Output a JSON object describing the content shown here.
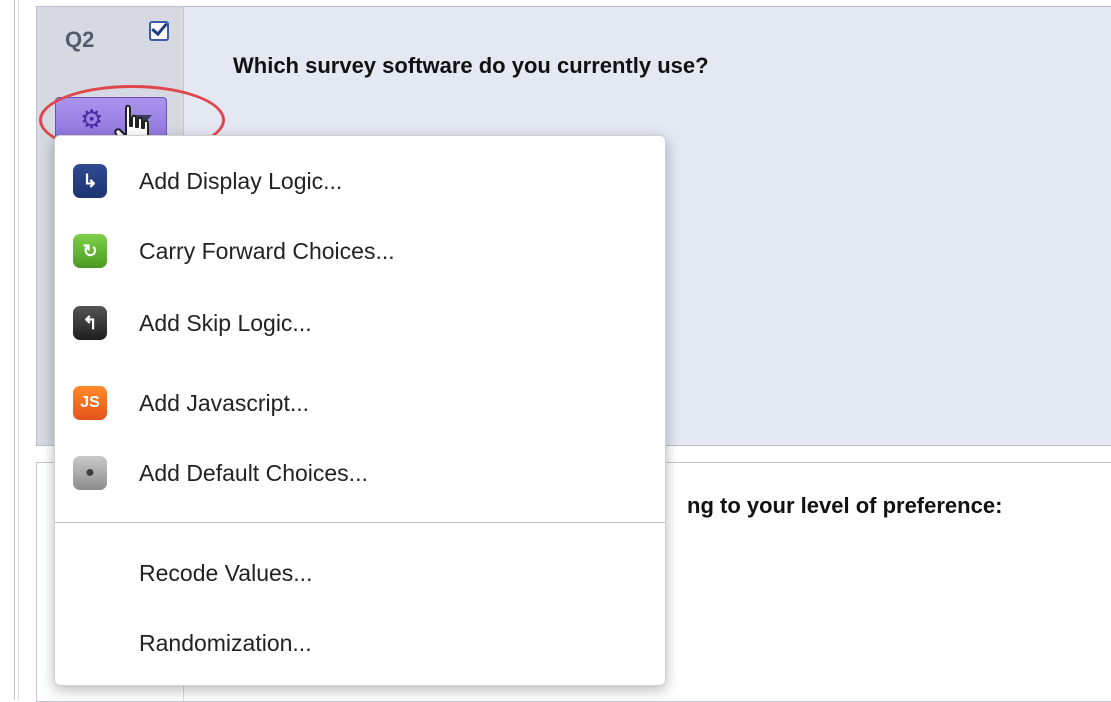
{
  "question2": {
    "number": "Q2",
    "text": "Which survey software do you currently use?"
  },
  "question3": {
    "text_visible": "ng to your level of preference:"
  },
  "menu": {
    "items": [
      {
        "label": "Add Display Logic...",
        "icon": "display-logic-icon",
        "glyph": "↳"
      },
      {
        "label": "Carry Forward Choices...",
        "icon": "carry-forward-icon",
        "glyph": "↻"
      },
      {
        "label": "Add Skip Logic...",
        "icon": "skip-logic-icon",
        "glyph": "↰"
      },
      {
        "label": "Add Javascript...",
        "icon": "javascript-icon",
        "glyph": "JS"
      },
      {
        "label": "Add Default Choices...",
        "icon": "default-choices-icon",
        "glyph": "●"
      }
    ],
    "plain_items": [
      {
        "label": "Recode Values..."
      },
      {
        "label": "Randomization..."
      }
    ]
  },
  "colors": {
    "question_bg": "#e4e8f3",
    "gear_button": "#9a80e4",
    "highlight": "#e0474c"
  }
}
